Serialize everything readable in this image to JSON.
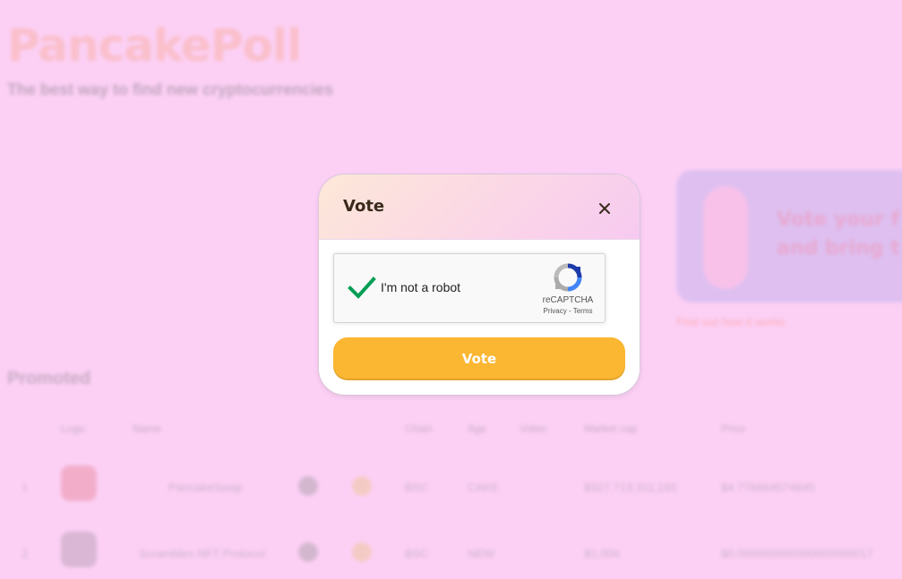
{
  "background": {
    "brand": "PancakePoll",
    "tagline": "The best way to find new cryptocurrencies",
    "banner_text": "Vote your f\nand bring t",
    "banner_link": "Find out how it works",
    "section_title": "Promoted",
    "table_headers": [
      "Logo",
      "Name",
      "Chain",
      "Age",
      "Votes",
      "Market cap",
      "Price"
    ],
    "rows": [
      {
        "rank": "1",
        "name": "PancakeSwap",
        "chain_value": "BSC",
        "symbol": "CAKE",
        "market_cap": "$327,713,311,165",
        "price": "$4.776664574645"
      },
      {
        "rank": "2",
        "name": "Scrambles NFT Protocol",
        "chain_value": "BSC",
        "symbol": "NEW",
        "market_cap": "$1,004",
        "price": "$0.000000000000000000017"
      }
    ]
  },
  "modal": {
    "title": "Vote",
    "captcha": {
      "label": "I'm not a robot",
      "brand": "reCAPTCHA",
      "privacy": "Privacy",
      "separator": " - ",
      "terms": "Terms",
      "checked": true
    },
    "vote_label": "Vote"
  },
  "colors": {
    "page_bg": "#fcd0f5",
    "accent": "#fbb632",
    "check_green": "#009e55",
    "title": "#3a2a1a"
  }
}
